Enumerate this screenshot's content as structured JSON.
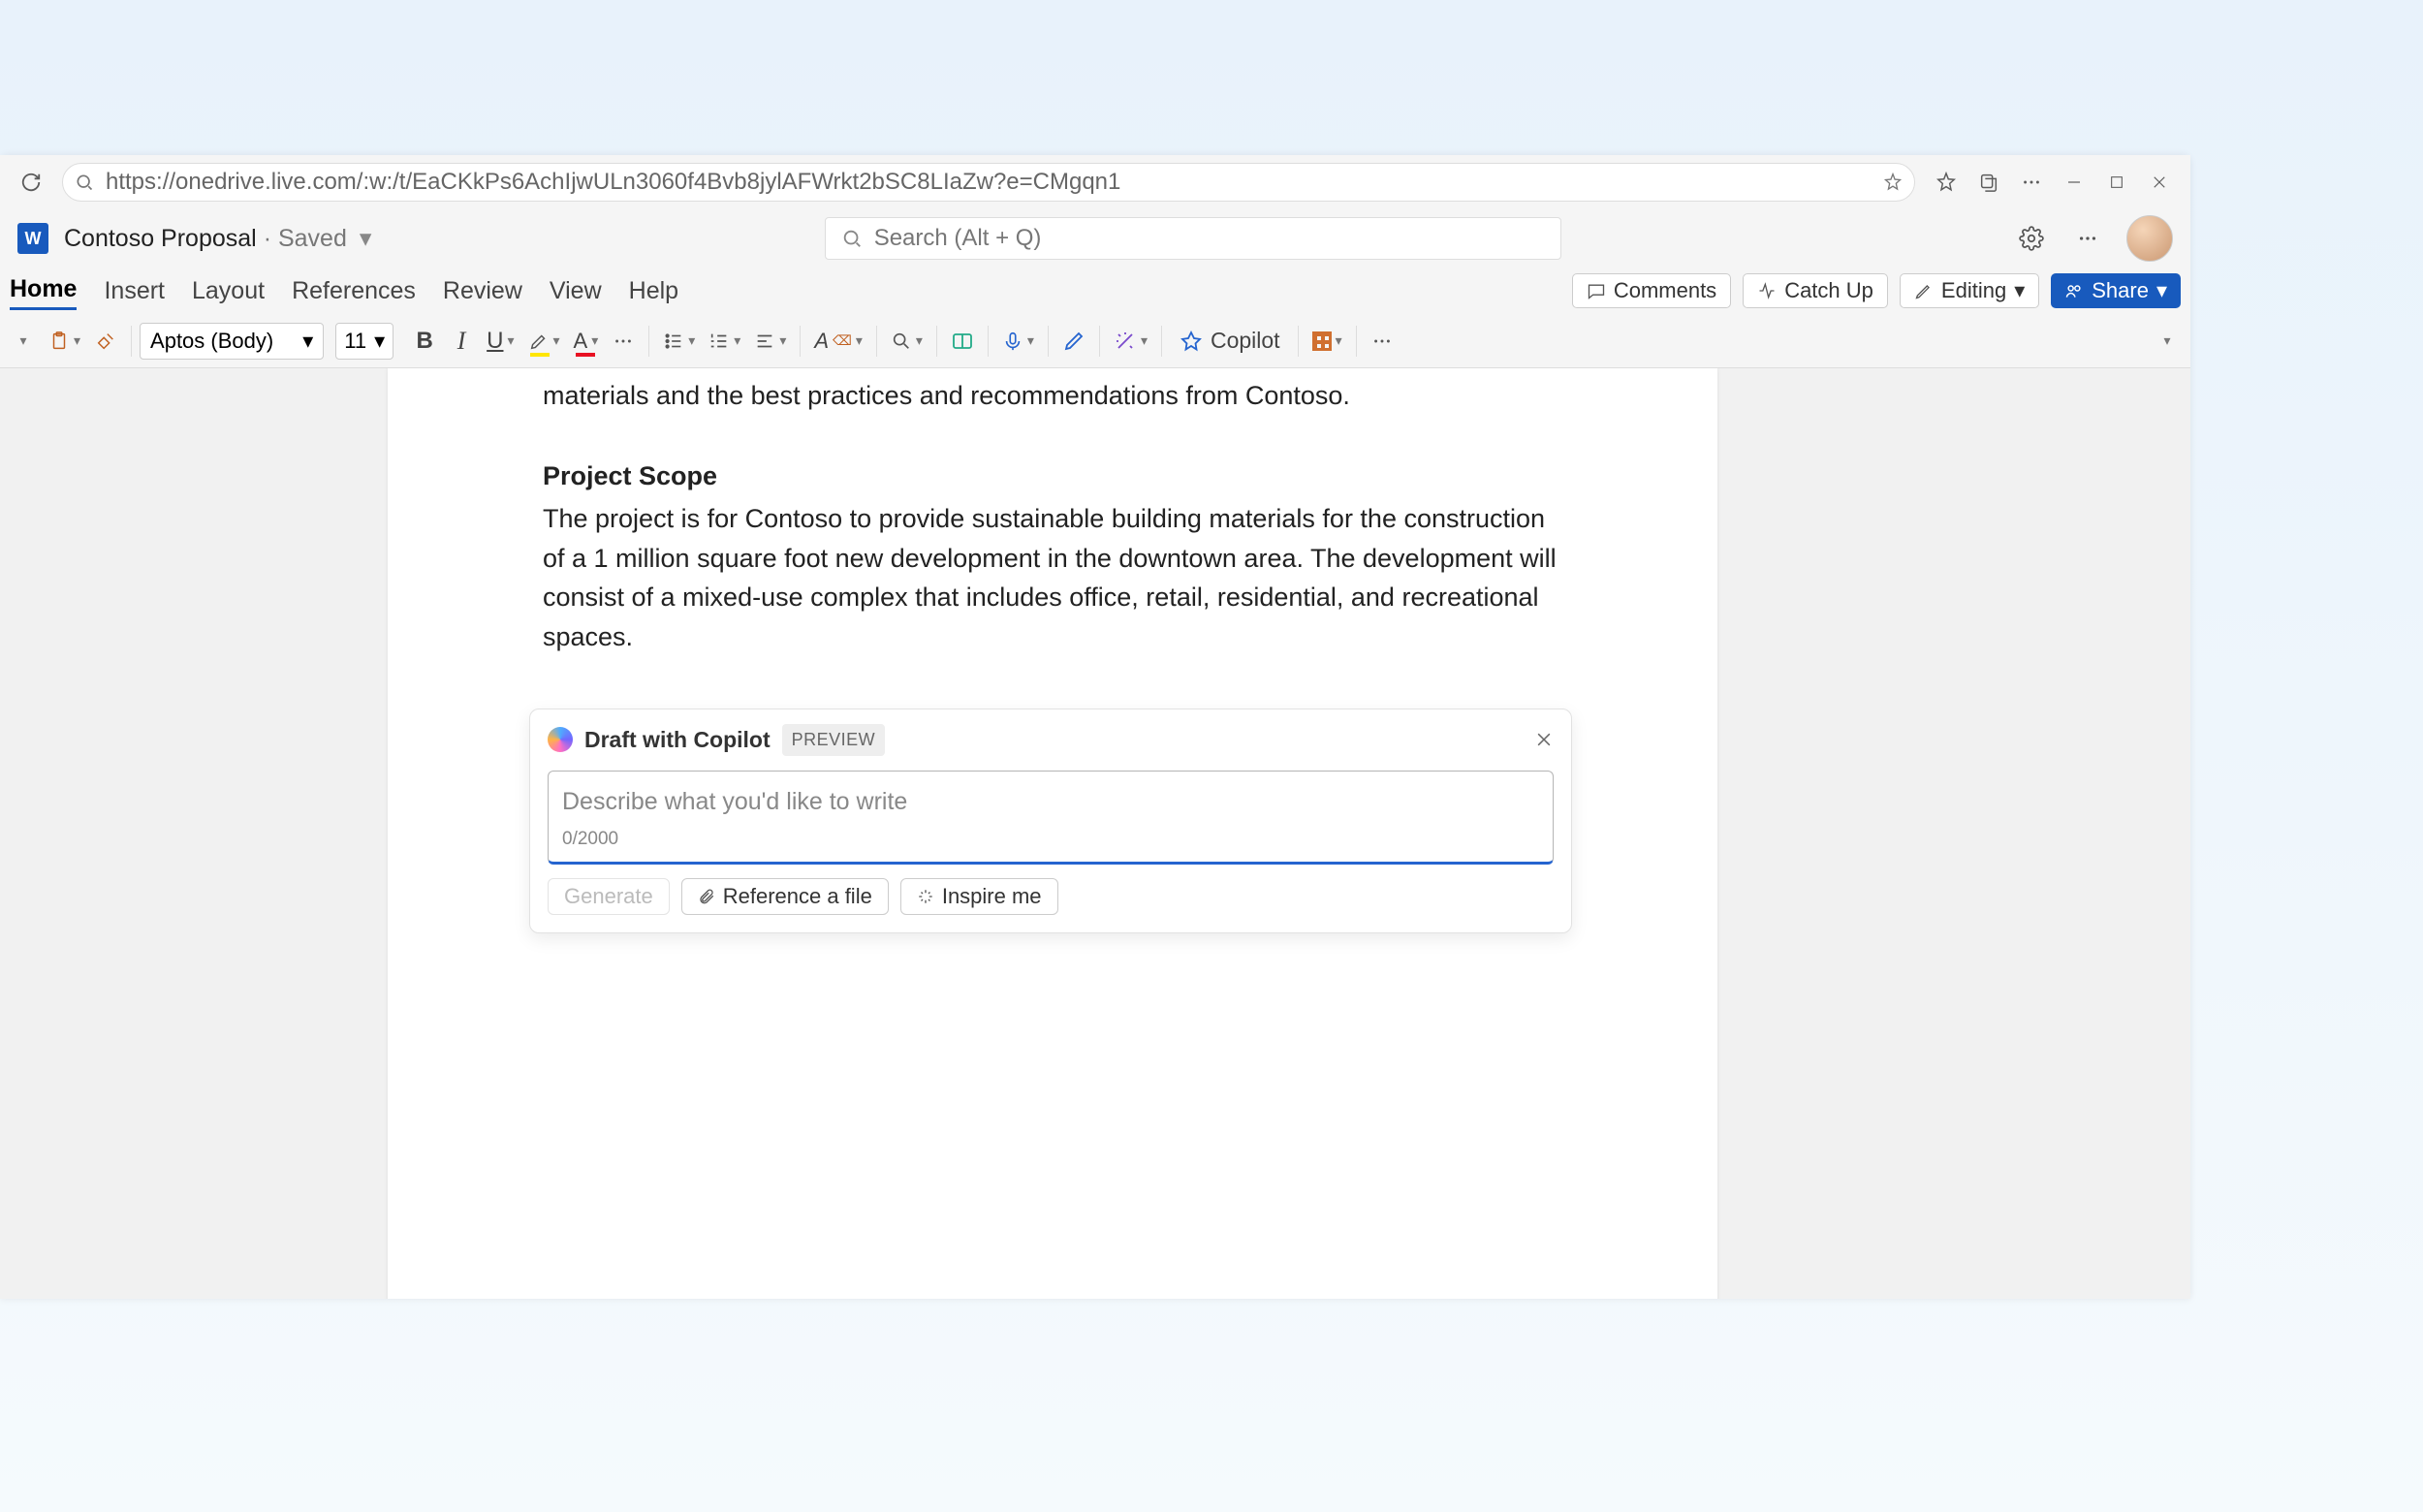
{
  "browser": {
    "url": "https://onedrive.live.com/:w:/t/EaCKkPs6AchIjwULn3060f4Bvb8jylAFWrkt2bSC8LIaZw?e=CMgqn1"
  },
  "doc": {
    "title": "Contoso Proposal",
    "saved_label": "Saved"
  },
  "search": {
    "placeholder": "Search (Alt + Q)"
  },
  "tabs": {
    "home": "Home",
    "insert": "Insert",
    "layout": "Layout",
    "references": "References",
    "review": "Review",
    "view": "View",
    "help": "Help"
  },
  "right_actions": {
    "comments": "Comments",
    "catch_up": "Catch Up",
    "editing": "Editing",
    "share": "Share"
  },
  "toolbar": {
    "font_name": "Aptos (Body)",
    "font_size": "11",
    "copilot_label": "Copilot"
  },
  "content": {
    "truncated_line": "materials and the best practices and recommendations from Contoso.",
    "section_heading": "Project Scope",
    "section_body": "The project is for Contoso to provide sustainable building materials for the construction of a 1 million square foot new development in the downtown area. The development will consist of a mixed-use complex that includes office, retail, residential, and recreational spaces."
  },
  "copilot": {
    "title": "Draft with Copilot",
    "preview_badge": "PREVIEW",
    "placeholder": "Describe what you'd like to write",
    "counter": "0/2000",
    "generate": "Generate",
    "reference_file": "Reference a file",
    "inspire_me": "Inspire me"
  }
}
